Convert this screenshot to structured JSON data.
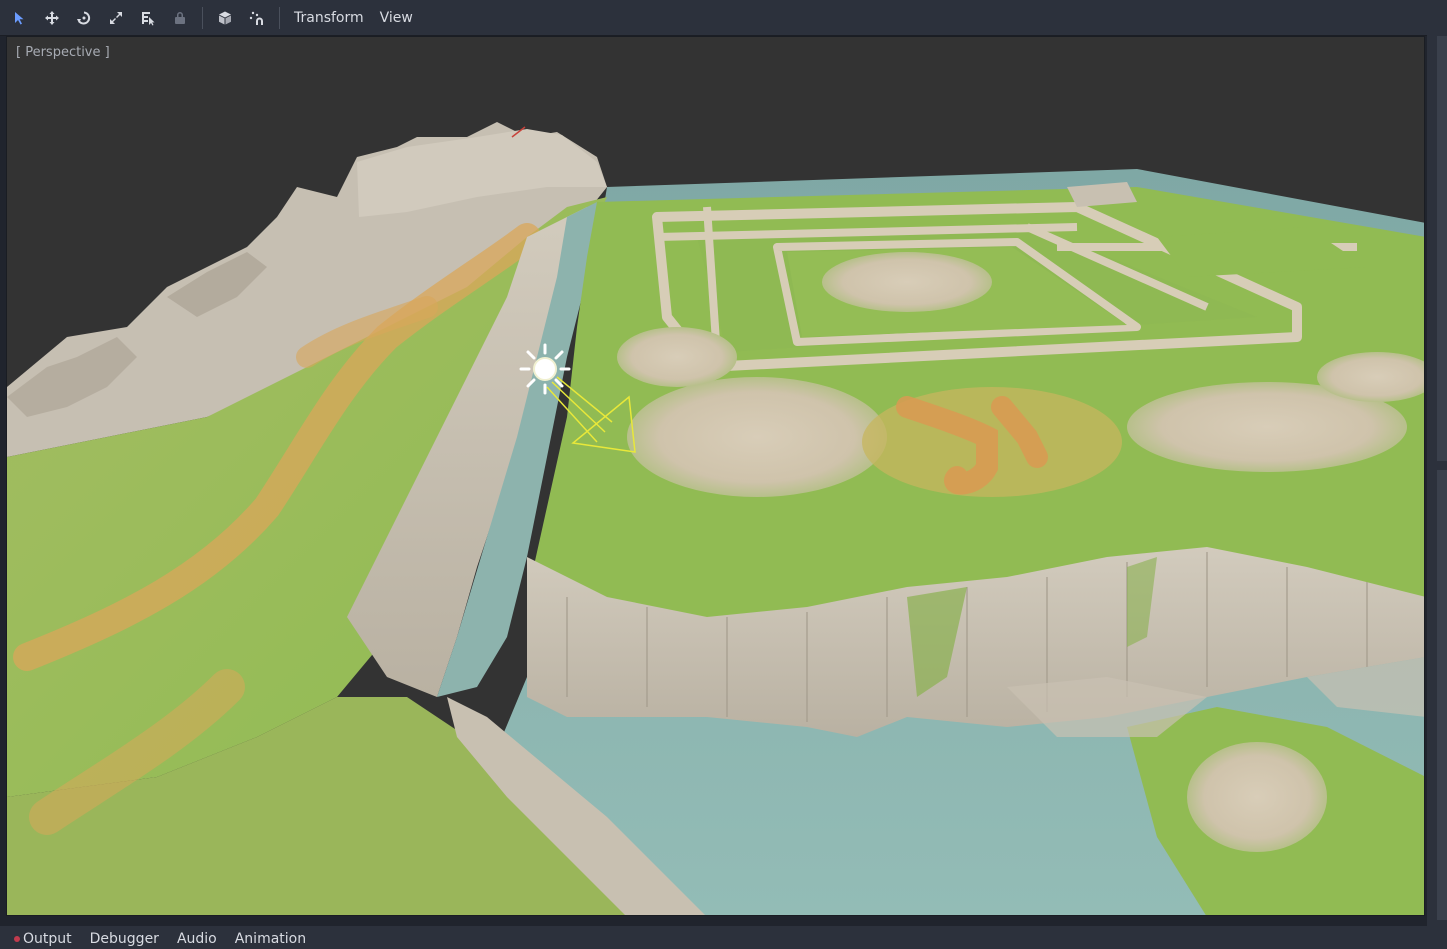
{
  "toolbar": {
    "tools": [
      {
        "icon": "select-arrow-icon",
        "active": true
      },
      {
        "icon": "move-icon",
        "active": false
      },
      {
        "icon": "rotate-icon",
        "active": false
      },
      {
        "icon": "scale-icon",
        "active": false
      },
      {
        "icon": "list-select-icon",
        "active": false
      },
      {
        "icon": "lock-icon",
        "active": false,
        "disabled": true
      },
      {
        "icon": "cube-icon",
        "active": false
      },
      {
        "icon": "snap-icon",
        "active": false
      }
    ],
    "menus": {
      "transform": "Transform",
      "view": "View"
    }
  },
  "viewport": {
    "label": "[ Perspective ]"
  },
  "bottom_tabs": {
    "output": "Output",
    "debugger": "Debugger",
    "audio": "Audio",
    "animation": "Animation"
  },
  "colors": {
    "editor_bg": "#2c313c",
    "sky": "#333333",
    "grass": "#8fba55",
    "rock": "#c9c2b4",
    "water": "#8fb7b0",
    "dirt": "#d9a75a",
    "accent": "#6b9cff",
    "gizmo": "#e8e83a"
  }
}
